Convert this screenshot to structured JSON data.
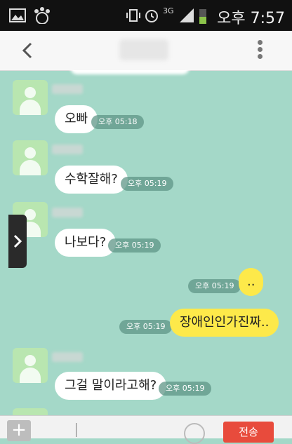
{
  "status_bar": {
    "time": "오후 7:57",
    "network": "3G"
  },
  "header": {
    "back_icon": "chevron-left-icon",
    "menu_icon": "kebab-menu-icon"
  },
  "messages": [
    {
      "side": "left",
      "text": "오빠",
      "time": "오후 05:18"
    },
    {
      "side": "left",
      "text": "수학잘해?",
      "time": "오후 05:19"
    },
    {
      "side": "left",
      "text": "나보다?",
      "time": "오후 05:19"
    },
    {
      "side": "right",
      "text": "..",
      "time": "오후 05:19"
    },
    {
      "side": "right",
      "text": "장애인인가진짜..",
      "time": "오후 05:19"
    },
    {
      "side": "left",
      "text": "그걸 말이라고해?",
      "time": "오후 05:19"
    }
  ],
  "input_bar": {
    "send_label": "전송"
  },
  "colors": {
    "chat_bg": "#a4d8c8",
    "my_bubble": "#fde94a",
    "send_button": "#e84b3c"
  }
}
